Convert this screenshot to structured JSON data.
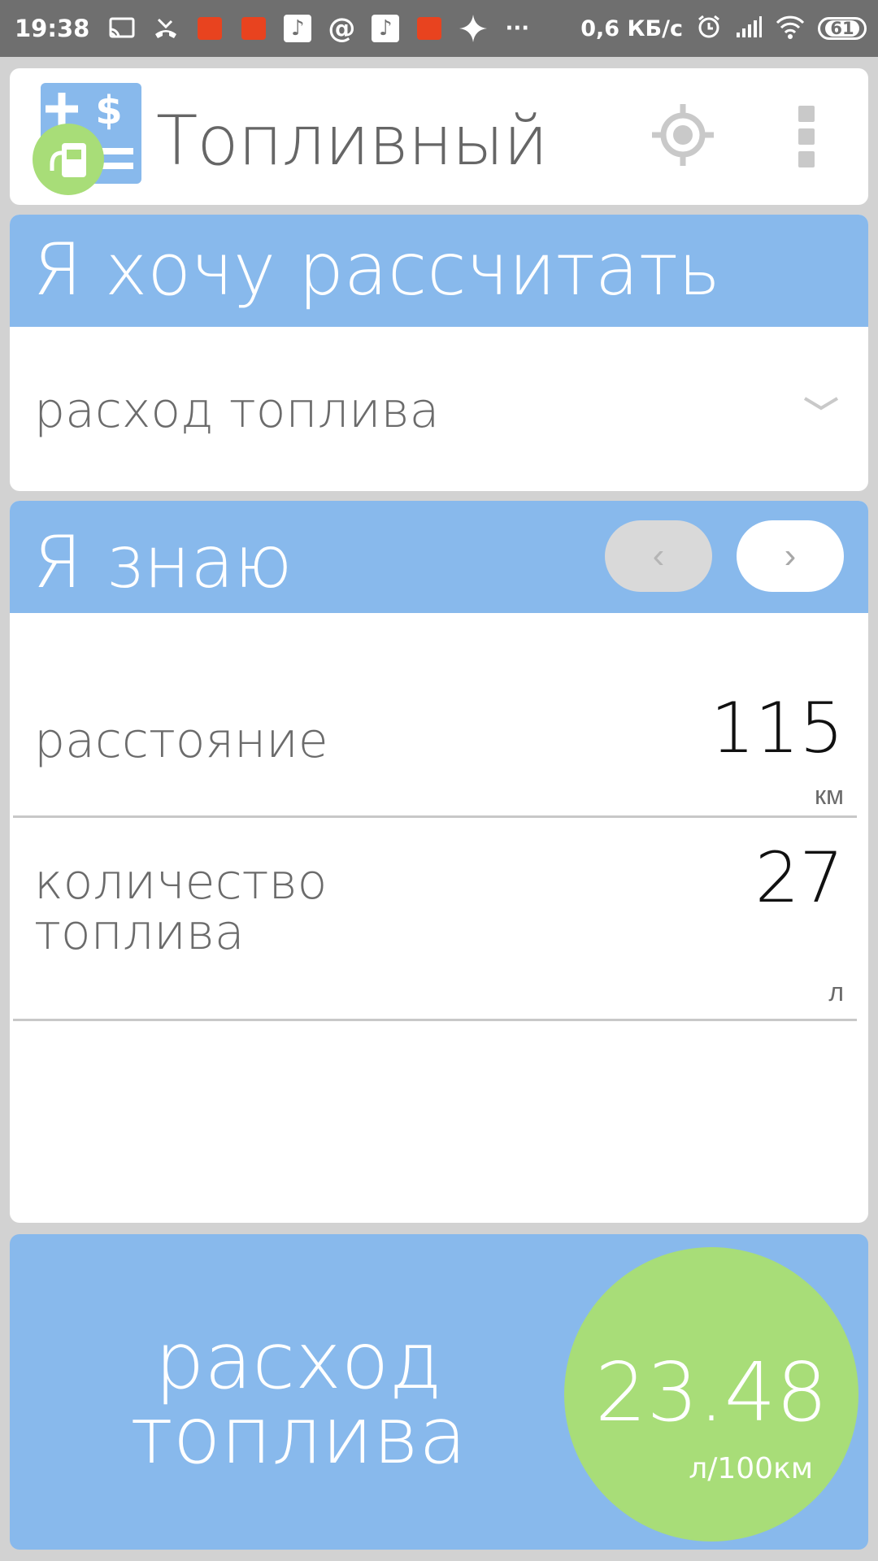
{
  "status_bar": {
    "time": "19:38",
    "network_speed": "0,6 КБ/с",
    "battery": "61",
    "icons": [
      "cast-icon",
      "missed-call-icon",
      "aliexpress-icon",
      "aliexpress-icon",
      "music-icon",
      "at-icon",
      "music-icon",
      "aliexpress-icon",
      "sparkle-icon",
      "more-dots-icon",
      "alarm-icon",
      "signal-icon",
      "wifi-icon",
      "battery-icon"
    ]
  },
  "header": {
    "title": "Топливный",
    "icons": [
      "app-logo-icon",
      "location-target-icon",
      "more-vertical-icon"
    ]
  },
  "want": {
    "title": "Я хочу рассчитать",
    "selected": "расход топлива"
  },
  "know": {
    "title": "Я знаю",
    "prev": "‹",
    "next": "›",
    "fields": [
      {
        "label": "расстояние",
        "value": "115",
        "unit": "км"
      },
      {
        "label": "количество\nтоплива",
        "value": "27",
        "unit": "л"
      }
    ]
  },
  "result": {
    "label": "расход топлива",
    "value": "23.48",
    "unit": "л/100км"
  },
  "colors": {
    "accent_blue": "#88b9ec",
    "result_green": "#a8dd78",
    "status_bar": "#6f6f6f",
    "background": "#d2d2d2"
  }
}
